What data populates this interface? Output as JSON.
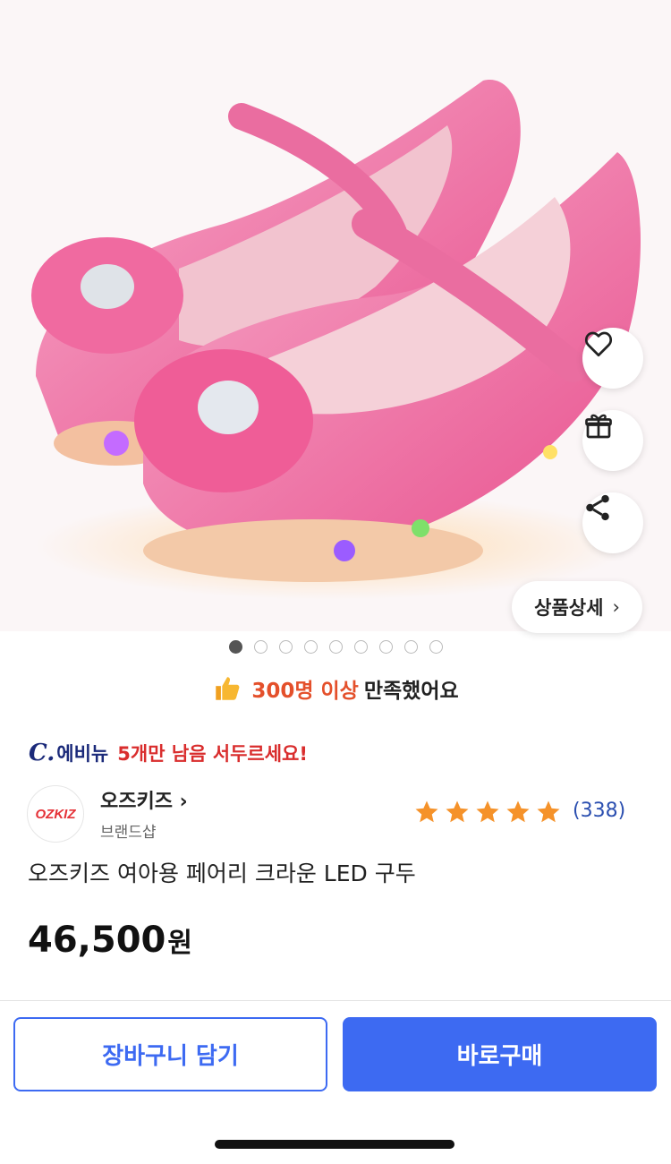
{
  "product_image": {
    "alt": "pink glitter princess shoes with bow",
    "page_count": 9,
    "active_page": 1
  },
  "actions": {
    "wishlist_icon": "heart-icon",
    "gift_icon": "gift-icon",
    "share_icon": "share-icon"
  },
  "detail_button": {
    "label": "상품상세",
    "chevron": "›"
  },
  "satisfaction": {
    "highlight": "300명 이상",
    "text": "만족했어요"
  },
  "delivery": {
    "logo": "C.",
    "shop": "에비뉴",
    "urgency": "5개만 남음 서두르세요!"
  },
  "brand": {
    "logo_text": "OZKIZ",
    "name": "오즈키즈",
    "chevron": "›",
    "sub": "브랜드샵"
  },
  "rating": {
    "stars": 5,
    "count": "(338)"
  },
  "product": {
    "title": "오즈키즈 여아용 페어리 크라운 LED 구두",
    "price": "46,500",
    "currency": "원"
  },
  "bottom": {
    "cart_label": "장바구니 담기",
    "buy_label": "바로구매"
  },
  "colors": {
    "accent": "#3d6af2",
    "urgent": "#d92d2d",
    "highlight": "#e4502b",
    "star": "#f5922a"
  }
}
